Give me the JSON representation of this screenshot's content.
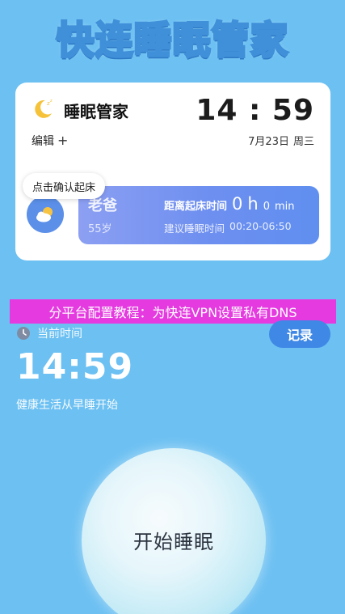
{
  "banner": {
    "title": "快连睡眠管家"
  },
  "card": {
    "title": "睡眠管家",
    "edit_label": "编辑",
    "plus": "+",
    "time": "14 : 59",
    "date": "7月23日",
    "weekday": "周三",
    "tooltip": "点击确认起床",
    "person": {
      "name": "老爸",
      "age": "55岁"
    },
    "countdown": {
      "label": "距离起床时间",
      "value": "0",
      "unit_h": "h",
      "value2": "0",
      "unit_min": "min"
    },
    "suggest": {
      "label": "建议睡眠时间",
      "range": "00:20-06:50"
    }
  },
  "ad": {
    "text": "分平台配置教程：为快连VPN设置私有DNS"
  },
  "current": {
    "label": "当前时间",
    "time": "14:59",
    "record_label": "记录",
    "tagline": "健康生活从早睡开始"
  },
  "start": {
    "label": "开始睡眠"
  },
  "colors": {
    "background": "#6cc0f2",
    "ad": "#e53ae0",
    "record_btn": "#3f88e6",
    "alarm_panel": "#6d8ff0"
  },
  "icons": [
    "moon-icon",
    "plus-icon",
    "weather-icon",
    "clock-icon"
  ]
}
